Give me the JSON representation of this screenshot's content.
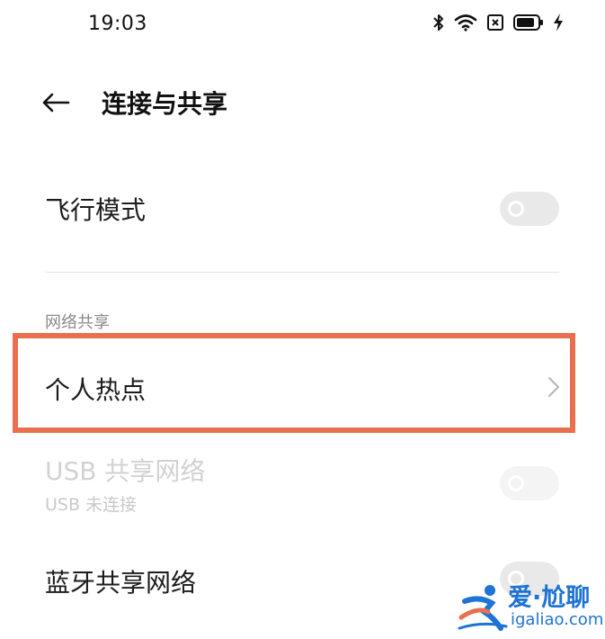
{
  "status_bar": {
    "time": "19:03",
    "icons": [
      "bluetooth-icon",
      "wifi-icon",
      "sim-disabled-icon",
      "battery-icon",
      "charging-icon"
    ]
  },
  "header": {
    "back_icon": "arrow-left-icon",
    "title": "连接与共享"
  },
  "settings": {
    "airplane_mode": {
      "label": "飞行模式",
      "enabled": false
    },
    "section_header": "网络共享",
    "personal_hotspot": {
      "label": "个人热点",
      "icon": "chevron-right-icon"
    },
    "usb_tethering": {
      "label": "USB 共享网络",
      "sublabel": "USB 未连接",
      "enabled": false,
      "disabled": true
    },
    "bluetooth_tethering": {
      "label": "蓝牙共享网络",
      "enabled": false
    }
  },
  "watermark": {
    "brand": "爱·尬聊",
    "url": "igaliao.com"
  },
  "colors": {
    "highlight": "#e8704f",
    "toggle_off": "#e9e9ea",
    "watermark_blue": "#1e73d4"
  }
}
